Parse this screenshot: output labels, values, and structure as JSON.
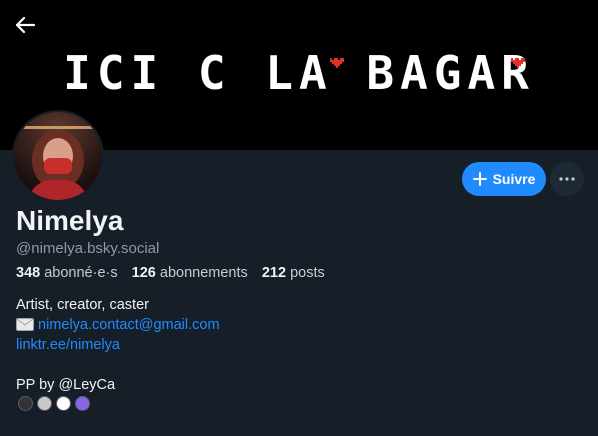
{
  "banner": {
    "text": "ICI C LA BAGAR",
    "background_color": "#000000",
    "heart_color": "#e0302e"
  },
  "profile": {
    "display_name": "Nimelya",
    "handle": "@nimelya.bsky.social",
    "follow_label": "Suivre",
    "stats": {
      "followers_count": "348",
      "followers_label": "abonné·e·s",
      "following_count": "126",
      "following_label": "abonnements",
      "posts_count": "212",
      "posts_label": "posts"
    },
    "bio": {
      "line1": "Artist, creator, caster",
      "email": "nimelya.contact@gmail.com",
      "link": "linktr.ee/nimelya",
      "line4": "PP by @LeyCa",
      "dot_colors": [
        "#333333",
        "#c8c8c8",
        "#ffffff",
        "#8a63e6"
      ]
    }
  },
  "colors": {
    "accent": "#208bfe",
    "background": "#161e27",
    "muted_text": "#8c9aab"
  },
  "icons": {
    "back": "arrow-left-icon",
    "follow": "plus-icon",
    "more": "ellipsis-icon",
    "email": "envelope-icon"
  }
}
